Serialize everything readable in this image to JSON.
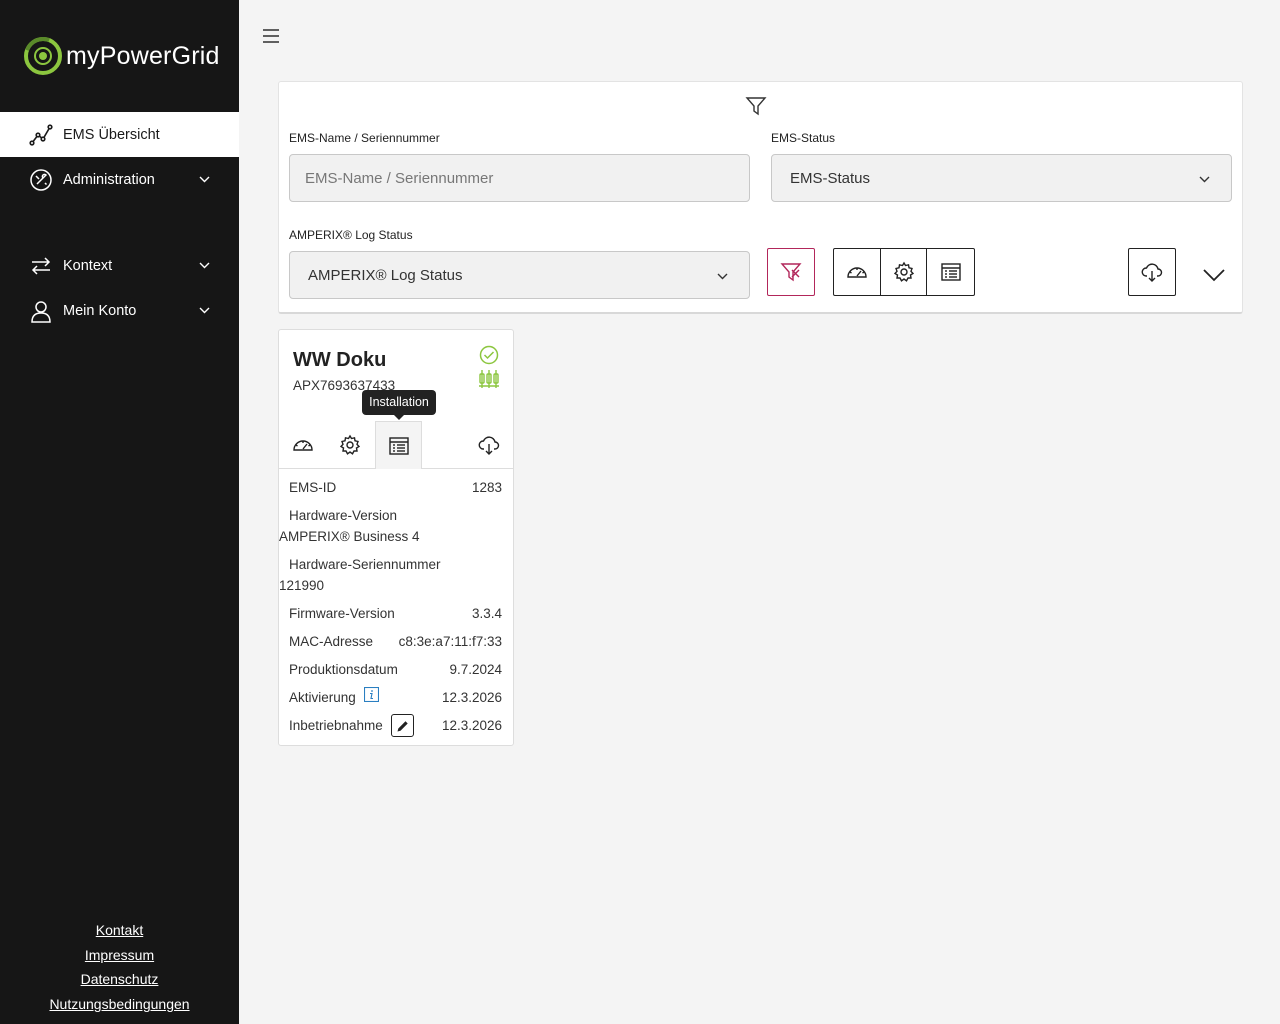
{
  "brand": {
    "name": "myPowerGrid",
    "accent": "#8cc63f"
  },
  "sidebar": {
    "items": [
      {
        "label": "EMS Übersicht",
        "icon": "chart-line-icon",
        "active": true
      },
      {
        "label": "Administration",
        "icon": "admin-icon"
      },
      {
        "label": "Kontext",
        "icon": "swap-arrows-icon"
      },
      {
        "label": "Mein Konto",
        "icon": "user-icon"
      }
    ],
    "footer": [
      "Kontakt",
      "Impressum",
      "Datenschutz",
      "Nutzungsbedingungen"
    ]
  },
  "filters": {
    "name_label": "EMS-Name / Seriennummer",
    "name_placeholder": "EMS-Name / Seriennummer",
    "status_label": "EMS-Status",
    "status_value": "EMS-Status",
    "log_label": "AMPERIX® Log Status",
    "log_value": "AMPERIX® Log Status",
    "clear_color": "#b2265a"
  },
  "card": {
    "title": "WW Doku",
    "serial": "APX7693637433",
    "tooltip": "Installation",
    "status_color": "#8cc63f",
    "props": {
      "ems_id_label": "EMS-ID",
      "ems_id": "1283",
      "hw_version_label": "Hardware-Version",
      "hw_version": "AMPERIX® Business 4",
      "hw_serial_label": "Hardware-Seriennummer",
      "hw_serial": "121990",
      "fw_label": "Firmware-Version",
      "fw": "3.3.4",
      "mac_label": "MAC-Adresse",
      "mac": "c8:3e:a7:11:f7:33",
      "prod_label": "Produktionsdatum",
      "prod": "9.7.2024",
      "activation_label": "Aktivierung",
      "activation": "12.3.2026",
      "commission_label": "Inbetriebnahme",
      "commission": "12.3.2026"
    }
  }
}
